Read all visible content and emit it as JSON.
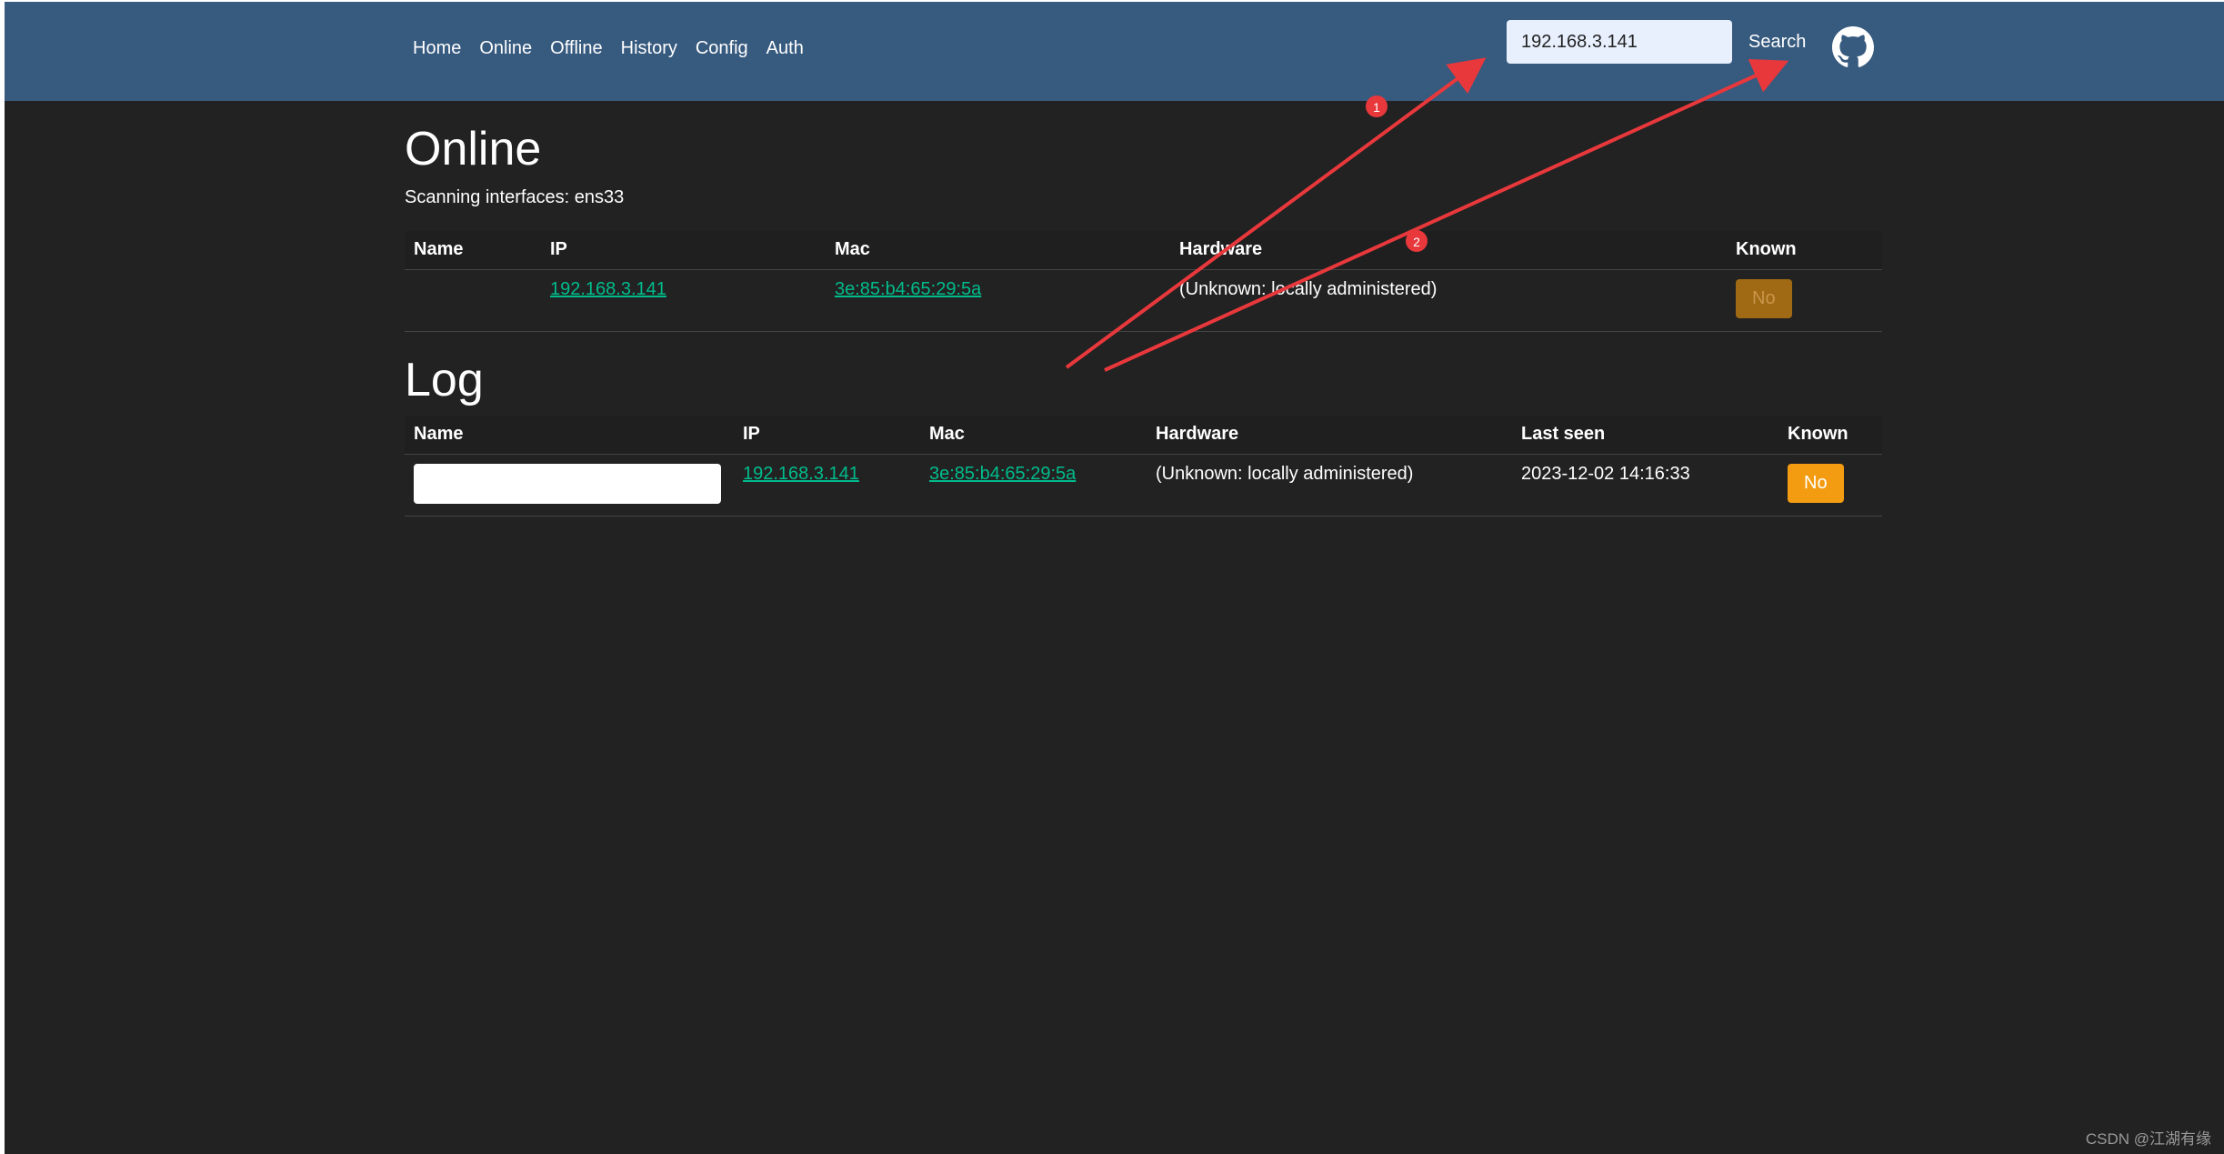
{
  "nav": {
    "links": [
      "Home",
      "Online",
      "Offline",
      "History",
      "Config",
      "Auth"
    ]
  },
  "search": {
    "value": "192.168.3.141",
    "button_label": "Search"
  },
  "github_icon": "github-icon",
  "online": {
    "title": "Online",
    "scan_text": "Scanning interfaces: ens33",
    "columns": [
      "Name",
      "IP",
      "Mac",
      "Hardware",
      "Known"
    ],
    "rows": [
      {
        "name": "",
        "ip": "192.168.3.141",
        "mac": "3e:85:b4:65:29:5a",
        "hardware": "(Unknown: locally administered)",
        "known": "No"
      }
    ]
  },
  "log": {
    "title": "Log",
    "columns": [
      "Name",
      "IP",
      "Mac",
      "Hardware",
      "Last seen",
      "Known"
    ],
    "rows": [
      {
        "name": "",
        "ip": "192.168.3.141",
        "mac": "3e:85:b4:65:29:5a",
        "hardware": "(Unknown: locally administered)",
        "last_seen": "2023-12-02 14:16:33",
        "known": "No"
      }
    ]
  },
  "annotations": {
    "marker1": "1",
    "marker2": "2",
    "color": "#e8383c"
  },
  "watermark": "CSDN @江湖有缘",
  "colors": {
    "navbar": "#375a7f",
    "background": "#222222",
    "link": "#00bc8c",
    "warning": "#f39c12"
  }
}
